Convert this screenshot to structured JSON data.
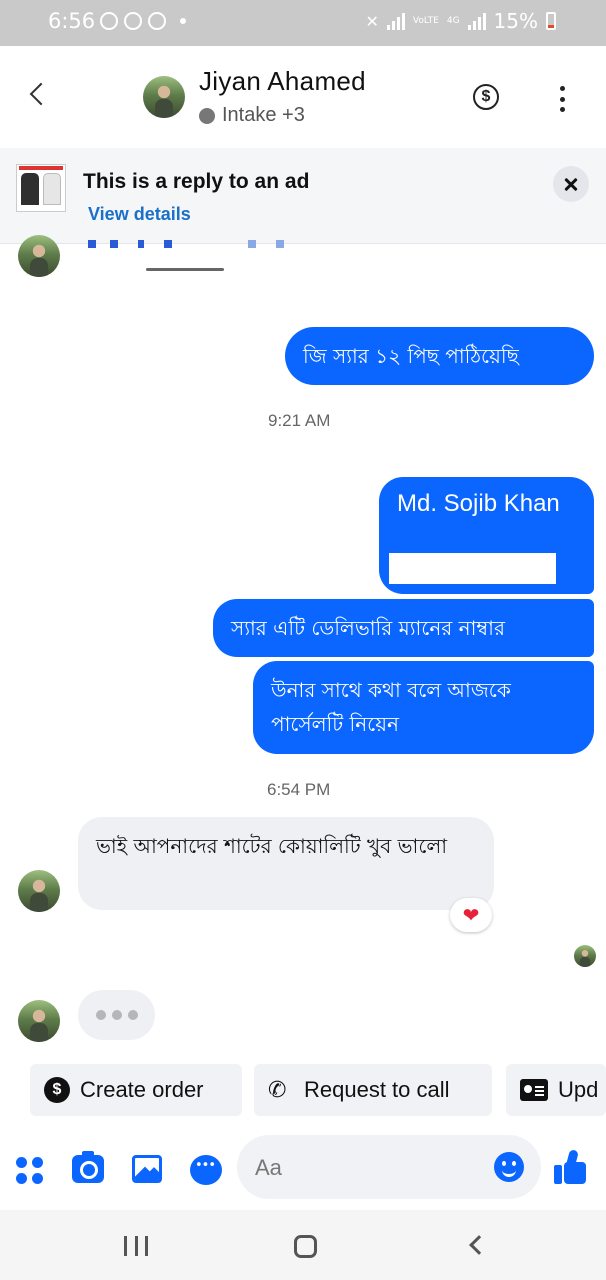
{
  "status_bar": {
    "time": "6:56",
    "battery": "15%",
    "network": "4G",
    "volte": "VoLTE"
  },
  "header": {
    "contact_name": "Jiyan Ahamed",
    "subtitle": "Intake +3"
  },
  "ad_banner": {
    "title": "This is a reply to an ad",
    "link": "View details"
  },
  "messages": [
    {
      "direction": "outgoing",
      "text": "জি স্যার ১২ পিছ পাঠিয়েছি"
    },
    {
      "direction": "outgoing",
      "text": "Md. Sojib Khan"
    },
    {
      "direction": "outgoing",
      "text": "স্যার এটি ডেলিভারি ম্যানের নাম্বার"
    },
    {
      "direction": "outgoing",
      "text": "উনার সাথে কথা বলে আজকে পার্সেলটি নিয়েন"
    },
    {
      "direction": "incoming",
      "text": "ভাই আপনাদের শাটের কোয়ালিটি খুব ভালো",
      "reaction": "heart"
    }
  ],
  "timestamps": [
    "9:21 AM",
    "6:54 PM"
  ],
  "quick_actions": [
    {
      "label": "Create order",
      "icon": "dollar-icon"
    },
    {
      "label": "Request to call",
      "icon": "phone-plus-icon"
    },
    {
      "label": "Upd",
      "icon": "contact-card-icon"
    }
  ],
  "composer": {
    "placeholder": "Aa"
  },
  "colors": {
    "messenger_blue": "#0a66ff",
    "incoming_bubble": "#eef0f3",
    "status_bar": "#c9c9c9"
  }
}
